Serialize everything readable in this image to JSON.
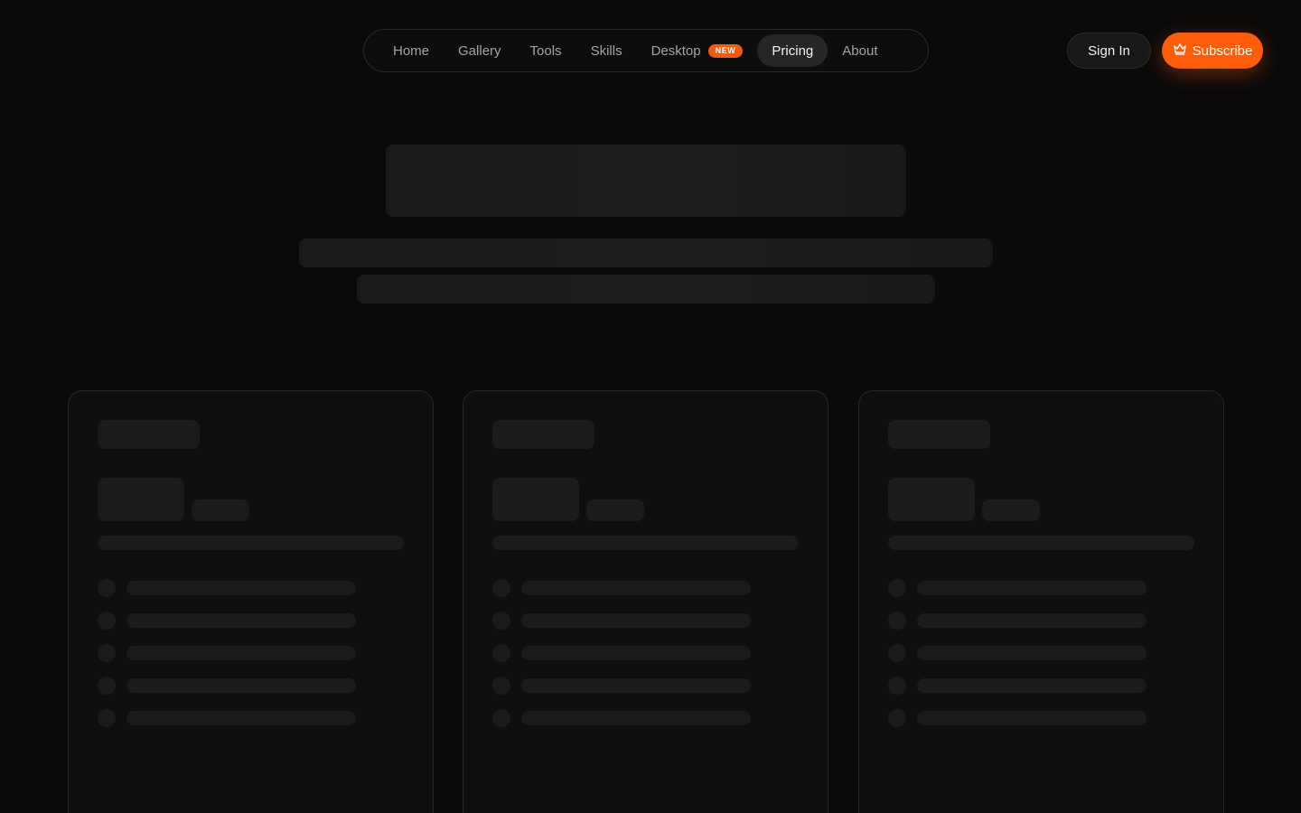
{
  "nav": {
    "items": [
      {
        "label": "Home"
      },
      {
        "label": "Gallery"
      },
      {
        "label": "Tools"
      },
      {
        "label": "Skills"
      },
      {
        "label": "Desktop",
        "badge": "NEW"
      },
      {
        "label": "Pricing",
        "active": true
      },
      {
        "label": "About"
      }
    ]
  },
  "auth": {
    "sign_in_label": "Sign In",
    "subscribe_label": "Subscribe",
    "subscribe_icon": "crown-icon"
  },
  "colors": {
    "background": "#0a0a0a",
    "accent": "#ff5d0a",
    "skeleton": "#1a1a1a"
  }
}
